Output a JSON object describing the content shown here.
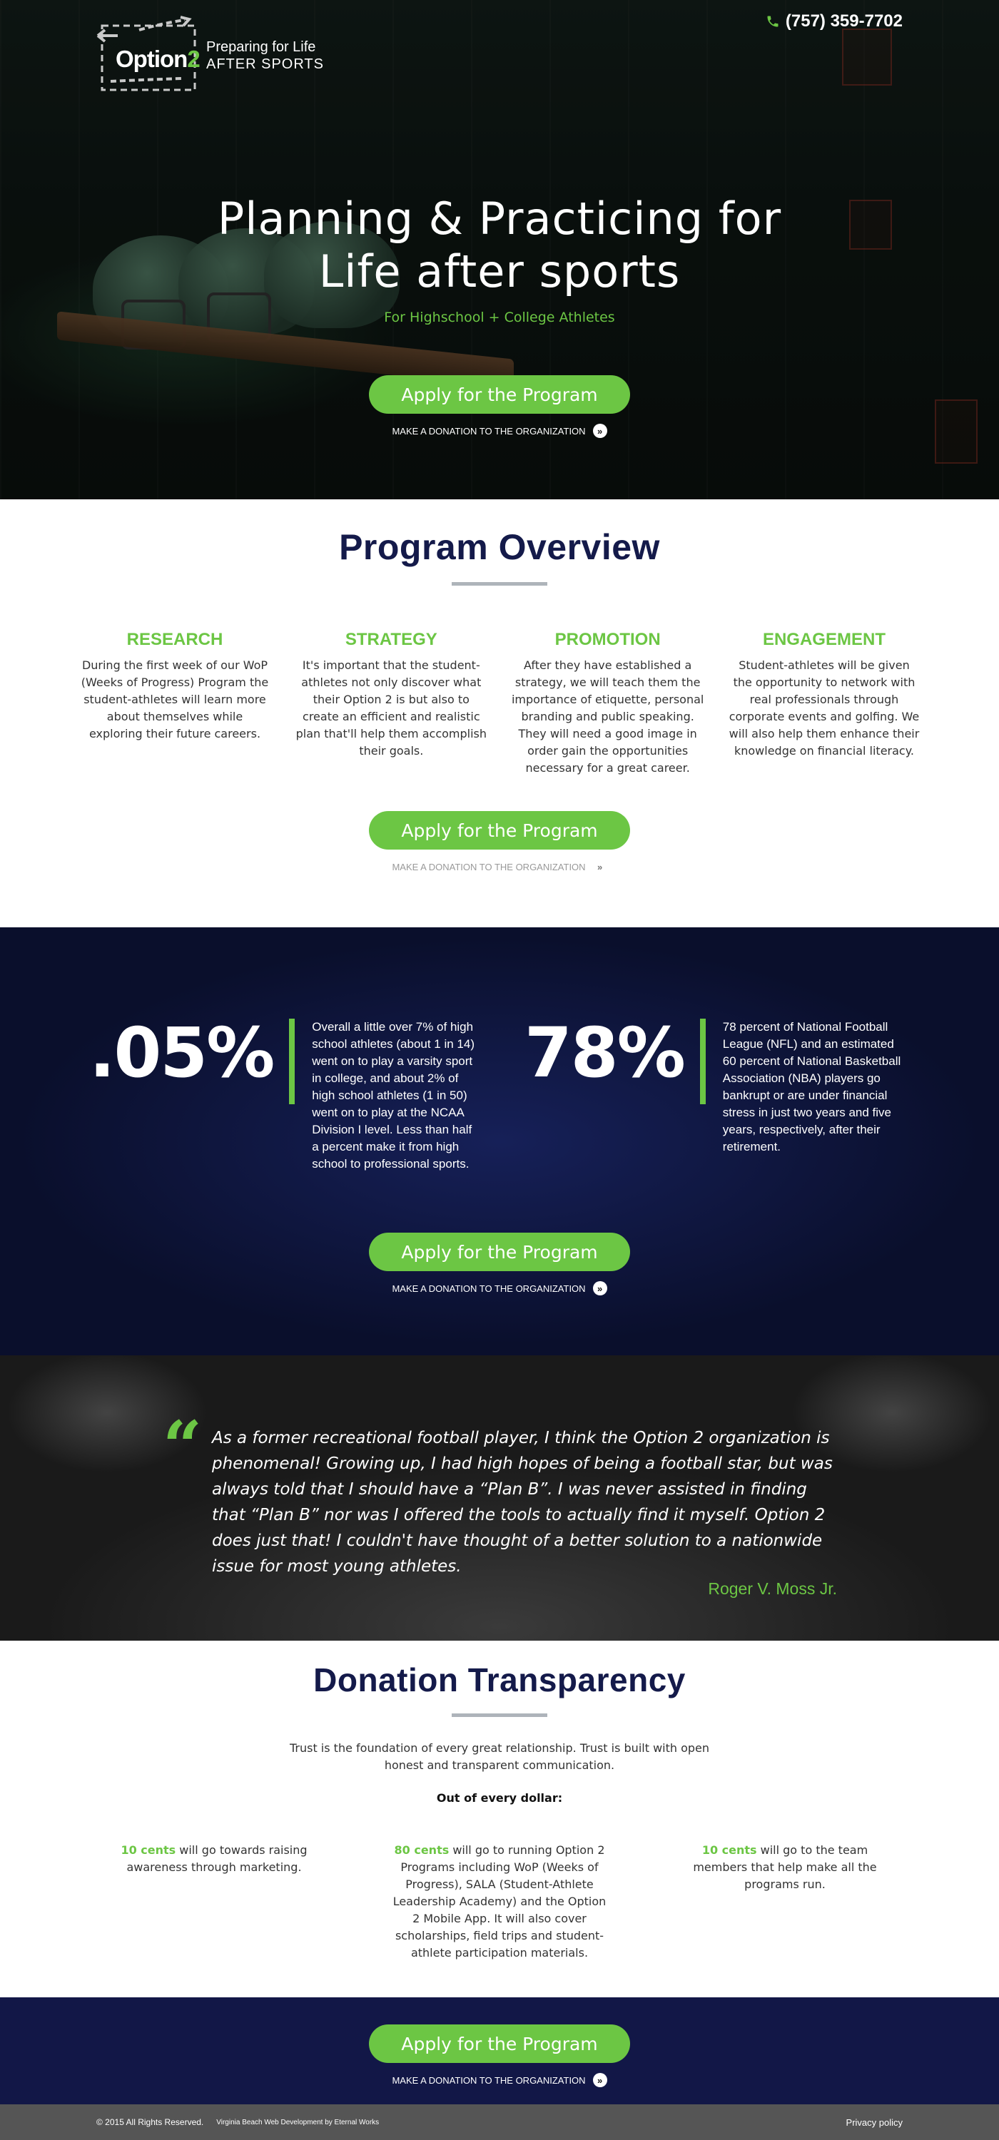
{
  "header": {
    "logo_text_a": "Option",
    "logo_text_b": "2",
    "tagline_1": "Preparing for Life",
    "tagline_2": "AFTER SPORTS",
    "phone": "(757) 359-7702",
    "phone_icon": "phone-icon"
  },
  "hero": {
    "title_line1": "Planning & Practicing for",
    "title_line2": "Life after sports",
    "subtitle": "For Highschool + College Athletes"
  },
  "cta": {
    "apply_label": "Apply for the Program",
    "donate_label": "MAKE A DONATION TO THE ORGANIZATION",
    "donate_icon": "chevron-right-circle-icon",
    "accent_color": "#6cc644"
  },
  "overview": {
    "title": "Program Overview",
    "columns": [
      {
        "heading": "RESEARCH",
        "text": "During the first week of our WoP (Weeks of Progress) Program the student-athletes will learn more about themselves while exploring their future careers."
      },
      {
        "heading": "STRATEGY",
        "text": "It's important that the student-athletes not only discover what their Option 2 is but also to create an efficient and realistic plan that'll help them accomplish their goals."
      },
      {
        "heading": "PROMOTION",
        "text": "After they have established a strategy, we will teach them the importance of etiquette, personal branding and public speaking. They will need a good image in order gain the opportunities necessary for a great career."
      },
      {
        "heading": "ENGAGEMENT",
        "text": "Student-athletes will be given the opportunity to network with real professionals through corporate events and golfing. We will also help them enhance their knowledge on financial literacy."
      }
    ]
  },
  "stats": [
    {
      "value": ".05%",
      "text": "Overall a little over 7% of high school athletes (about 1 in 14) went on to play a varsity sport in college, and about 2% of high school athletes (1 in 50) went on to play at the NCAA Division I level. Less than half a percent make it from high school to professional sports."
    },
    {
      "value": "78%",
      "text": "78 percent of National Football League (NFL) and an estimated 60 percent of National Basketball Association (NBA) players go bankrupt or are under financial stress in just two years and five years, respectively, after their retirement."
    }
  ],
  "testimonial": {
    "quote": "As a former recreational football player, I think the Option 2 organization is phenomenal! Growing up, I had high hopes of being a football star, but was always told that I should have a “Plan B”. I was never assisted in finding that “Plan B” nor was I offered the tools to actually find it myself. Option 2 does just that! I couldn't have thought of a better solution to a nationwide issue for most young athletes.",
    "author": "Roger V. Moss Jr.",
    "quote_icon": "quote-mark-icon"
  },
  "donation": {
    "title": "Donation Transparency",
    "intro": "Trust is the foundation of every great relationship.  Trust is built with open honest and transparent communication.",
    "out_of": "Out of every dollar:",
    "columns": [
      {
        "amount": "10 cents",
        "text": " will go towards raising awareness through marketing."
      },
      {
        "amount": "80 cents",
        "text": " will go to running Option 2 Programs including WoP (Weeks of Progress), SALA (Student-Athlete Leadership Academy) and the Option 2 Mobile App. It will also cover scholarships, field trips and student-athlete participation materials."
      },
      {
        "amount": "10 cents",
        "text": " will go to the team members that help make all the programs run."
      }
    ]
  },
  "footer": {
    "copyright": "© 2015 All Rights Reserved.",
    "credit": "Virginia Beach Web Development by Eternal Works",
    "privacy": "Privacy policy"
  }
}
